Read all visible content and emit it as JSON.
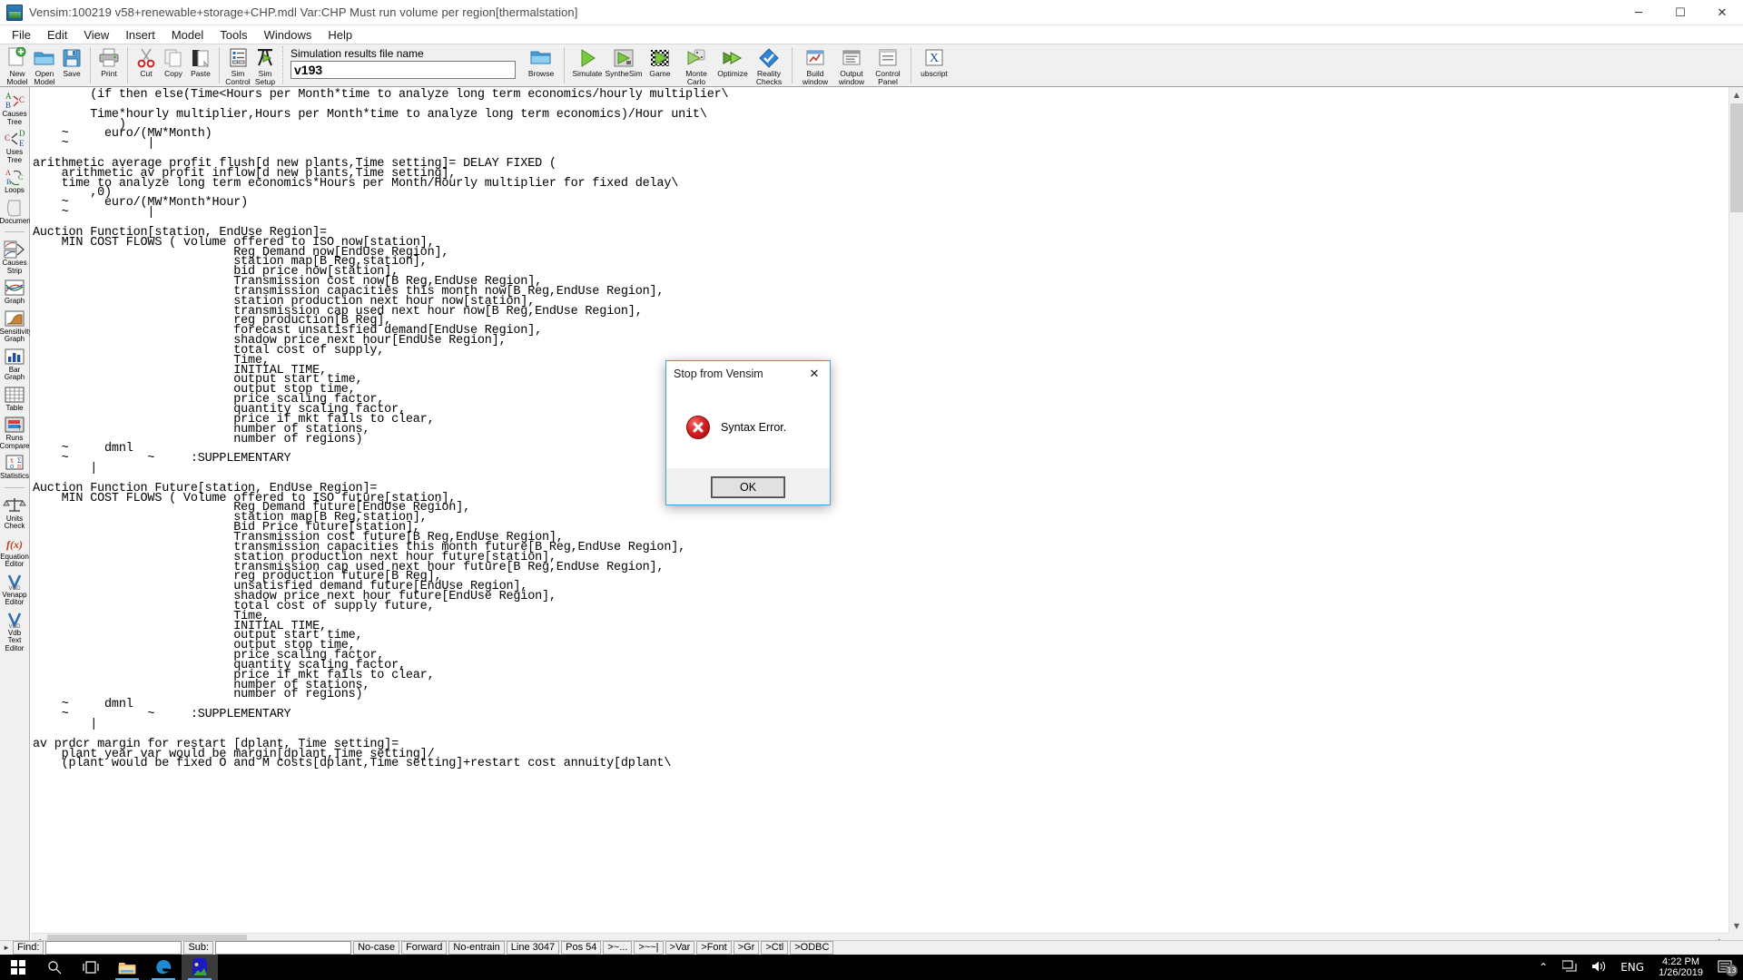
{
  "window": {
    "title": "Vensim:100219 v58+renewable+storage+CHP.mdl Var:CHP Must run volume per region[thermalstation]",
    "icon": "vensim-app-icon",
    "minimize": "─",
    "maximize": "☐",
    "close": "✕"
  },
  "menu": [
    "File",
    "Edit",
    "View",
    "Insert",
    "Model",
    "Tools",
    "Windows",
    "Help"
  ],
  "toolbar": {
    "buttons": [
      {
        "label": "New\nModel",
        "icon": "new-model-icon"
      },
      {
        "label": "Open\nModel",
        "icon": "open-model-icon"
      },
      {
        "label": "Save",
        "icon": "save-icon"
      },
      {
        "label": "Print",
        "icon": "print-icon"
      },
      {
        "label": "Cut",
        "icon": "cut-icon"
      },
      {
        "label": "Copy",
        "icon": "copy-icon"
      },
      {
        "label": "Paste",
        "icon": "paste-icon"
      },
      {
        "label": "Sim\nControl",
        "icon": "sim-control-icon"
      },
      {
        "label": "Sim\nSetup",
        "icon": "sim-setup-icon"
      }
    ],
    "simfile": {
      "label": "Simulation results file name",
      "value": "v193",
      "placeholder": "",
      "browse_label": "Browse",
      "browse_icon": "folder-icon"
    },
    "run_buttons": [
      {
        "label": "Simulate",
        "icon": "simulate-play-icon"
      },
      {
        "label": "SyntheSim",
        "icon": "synthesim-icon"
      },
      {
        "label": "Game",
        "icon": "game-icon"
      },
      {
        "label": "Monte\nCarlo",
        "icon": "monte-carlo-icon"
      },
      {
        "label": "Optimize",
        "icon": "optimize-icon"
      },
      {
        "label": "Reality\nChecks",
        "icon": "reality-checks-icon"
      },
      {
        "label": "Build\nwindow",
        "icon": "build-window-icon"
      },
      {
        "label": "Output\nwindow",
        "icon": "output-window-icon"
      },
      {
        "label": "Control\nPanel",
        "icon": "control-panel-icon"
      },
      {
        "label": "ubscript",
        "icon": "subscript-x-icon"
      }
    ]
  },
  "rail": {
    "items": [
      {
        "label": "Causes\nTree",
        "icon": "causes-tree-icon"
      },
      {
        "label": "Uses\nTree",
        "icon": "uses-tree-icon"
      },
      {
        "label": "Loops",
        "icon": "loops-icon"
      },
      {
        "label": "Document",
        "icon": "document-icon"
      },
      {
        "label": "Causes\nStrip",
        "icon": "causes-strip-icon"
      },
      {
        "label": "Graph",
        "icon": "graph-icon"
      },
      {
        "label": "Sensitivity\nGraph",
        "icon": "sensitivity-graph-icon"
      },
      {
        "label": "Bar\nGraph",
        "icon": "bar-graph-icon"
      },
      {
        "label": "Table",
        "icon": "table-icon"
      },
      {
        "label": "Runs\nCompare",
        "icon": "runs-compare-icon"
      },
      {
        "label": "Statistics",
        "icon": "statistics-icon"
      },
      {
        "label": "Units\nCheck",
        "icon": "units-check-icon"
      },
      {
        "label": "Equation\nEditor",
        "icon": "equation-editor-icon"
      },
      {
        "label": "Venapp\nEditor",
        "icon": "venapp-editor-icon"
      },
      {
        "label": "Vdb\nText\nEditor",
        "icon": "text-editor-icon"
      }
    ]
  },
  "editor": {
    "lines": [
      "        (if then else(Time<Hours per Month*time to analyze long term economics/hourly multiplier\\",
      "",
      "        Time*hourly multiplier,Hours per Month*time to analyze long term economics)/Hour unit\\",
      "            )",
      "    ~     euro/(MW*Month)",
      "    ~           |",
      "",
      "arithmetic average profit flush[d new plants,Time setting]= DELAY FIXED (",
      "    arithmetic av profit inflow[d new plants,Time setting],",
      "    time to analyze long term economics*Hours per Month/Hourly multiplier for fixed delay\\",
      "        ,0)",
      "    ~     euro/(MW*Month*Hour)",
      "    ~           |",
      "",
      "Auction Function[station, EndUse Region]=",
      "    MIN COST FLOWS ( volume offered to ISO now[station],",
      "                            Reg Demand now[EndUse Region],",
      "                            station map[B Reg,station],",
      "                            bid price now[station],",
      "                            Transmission cost now[B Reg,EndUse Region],",
      "                            transmission capacities this month now[B Reg,EndUse Region],",
      "                            station production next hour now[station],",
      "                            transmission cap used next hour now[B Reg,EndUse Region],",
      "                            reg production[B Reg],",
      "                            forecast unsatisfied demand[EndUse Region],",
      "                            shadow price next hour[EndUse Region],",
      "                            total cost of supply,",
      "                            Time,",
      "                            INITIAL TIME,",
      "                            output start time,",
      "                            output stop time,",
      "                            price scaling factor,",
      "                            quantity scaling factor,",
      "                            price if mkt fails to clear,",
      "                            number of stations,",
      "                            number of regions)",
      "    ~     dmnl",
      "    ~           ~     :SUPPLEMENTARY",
      "        |",
      "",
      "Auction Function Future[station, EndUse Region]=",
      "    MIN COST FLOWS ( Volume offered to ISO future[station],",
      "                            Reg Demand future[EndUse Region],",
      "                            station map[B Reg,station],",
      "                            Bid Price future[station],",
      "                            Transmission cost future[B Reg,EndUse Region],",
      "                            transmission capacities this month future[B Reg,EndUse Region],",
      "                            station production next hour future[station],",
      "                            transmission cap used next hour future[B Reg,EndUse Region],",
      "                            reg production future[B Reg],",
      "                            unsatisfied demand future[EndUse Region],",
      "                            shadow price next hour future[EndUse Region],",
      "                            total cost of supply future,",
      "                            Time,",
      "                            INITIAL TIME,",
      "                            output start time,",
      "                            output stop time,",
      "                            price scaling factor,",
      "                            quantity scaling factor,",
      "                            price if mkt fails to clear,",
      "                            number of stations,",
      "                            number of regions)",
      "    ~     dmnl",
      "    ~           ~     :SUPPLEMENTARY",
      "        |",
      "",
      "av prdcr margin for restart [dplant, Time setting]=",
      "    plant year var would be margin[dplant,Time setting]/",
      "    (plant would be fixed O and M costs[dplant,Time setting]+restart cost annuity[dplant\\"
    ]
  },
  "statusbar": {
    "find_label": "Find:",
    "find_value": "",
    "sub_label": "Sub:",
    "sub_value": "",
    "cells": [
      "No-case",
      "Forward",
      "No-entrain",
      "Line 3047",
      "Pos 54",
      ">~...",
      ">~~|",
      ">Var",
      ">Font",
      ">Gr",
      ">Ctl",
      ">ODBC"
    ]
  },
  "dialog": {
    "title": "Stop from Vensim",
    "close_icon": "close-icon",
    "message": "Syntax Error.",
    "icon": "error-icon",
    "ok_label": "OK"
  },
  "taskbar": {
    "start_icon": "windows-start-icon",
    "search_icon": "search-icon",
    "taskview_icon": "task-view-icon",
    "apps": [
      {
        "icon": "file-explorer-icon",
        "active": false
      },
      {
        "icon": "edge-browser-icon",
        "active": false
      },
      {
        "icon": "vensim-taskbar-icon",
        "active": true
      }
    ],
    "tray": {
      "chevron": "⌃",
      "network_icon": "network-icon",
      "volume_icon": "volume-icon",
      "language": "ENG",
      "time": "4:22 PM",
      "date": "1/26/2019",
      "notification_count": "13"
    }
  },
  "colors": {
    "accent": "#4a9fd8",
    "error": "#d32020",
    "toolbar_bg": "#f0f0f0",
    "taskbar_bg": "#000000"
  }
}
